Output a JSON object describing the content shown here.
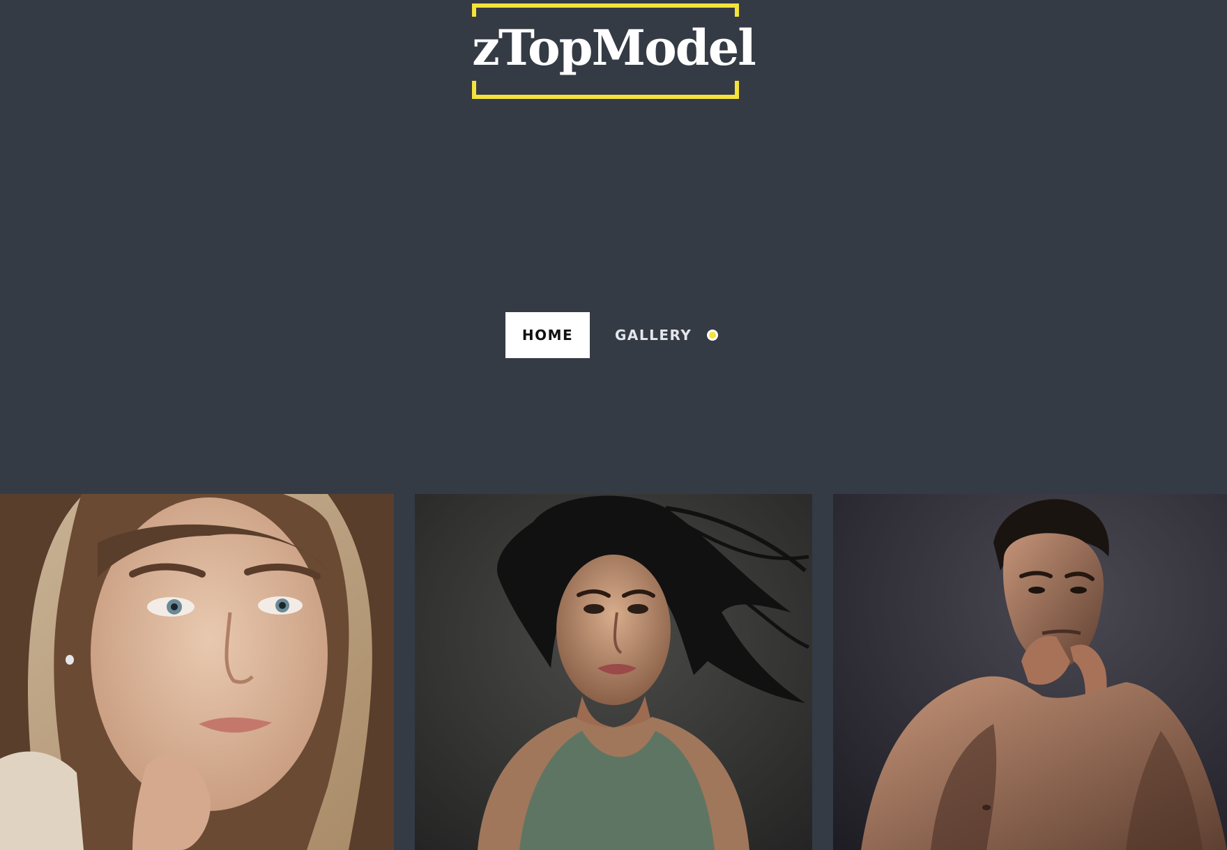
{
  "header": {
    "logo_text": "zTopModel"
  },
  "nav": {
    "items": [
      {
        "label": "HOME",
        "active": true
      },
      {
        "label": "GALLERY",
        "active": false
      }
    ]
  },
  "colors": {
    "background": "#353b45",
    "accent": "#f4e33a"
  },
  "gallery": {
    "items": [
      {
        "icon": "portrait-woman-light-hair"
      },
      {
        "icon": "portrait-woman-dark-hair"
      },
      {
        "icon": "portrait-man-shirtless"
      }
    ]
  }
}
